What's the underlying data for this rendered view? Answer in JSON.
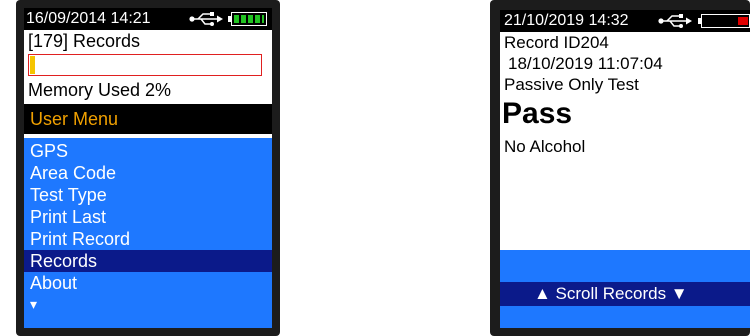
{
  "left_device": {
    "status": {
      "datetime": "16/09/2014 14:21",
      "usb_icon": "usb-icon",
      "battery_icon": "battery-full-icon",
      "battery_color": "#22c322"
    },
    "records_label": "[179] Records",
    "memory_label": "Memory Used 2%",
    "memory_used_fraction": 0.02,
    "menu_title": "User Menu",
    "menu_title_color": "#f0a000",
    "menu_items": [
      {
        "label": "GPS"
      },
      {
        "label": "Area Code"
      },
      {
        "label": "Test Type"
      },
      {
        "label": "Print Last"
      },
      {
        "label": "Print Record"
      },
      {
        "label": "Records"
      },
      {
        "label": "About"
      }
    ],
    "selected_item": "Records",
    "more_indicator": "▾",
    "menu_bg": "#1e78ff",
    "menu_selected_bg": "#0b1a8a"
  },
  "right_device": {
    "status": {
      "datetime": "21/10/2019  14:32",
      "usb_icon": "usb-icon",
      "battery_icon": "battery-low-icon",
      "battery_color": "#e00000"
    },
    "record_id": "Record ID204",
    "record_datetime": "18/10/2019 11:07:04",
    "test_type": "Passive Only Test",
    "result": "Pass",
    "result_detail": "No Alcohol",
    "scroll_label": "▲ Scroll Records ▼",
    "footer_bg": "#1e78ff",
    "scroll_bg": "#0b1a8a"
  }
}
